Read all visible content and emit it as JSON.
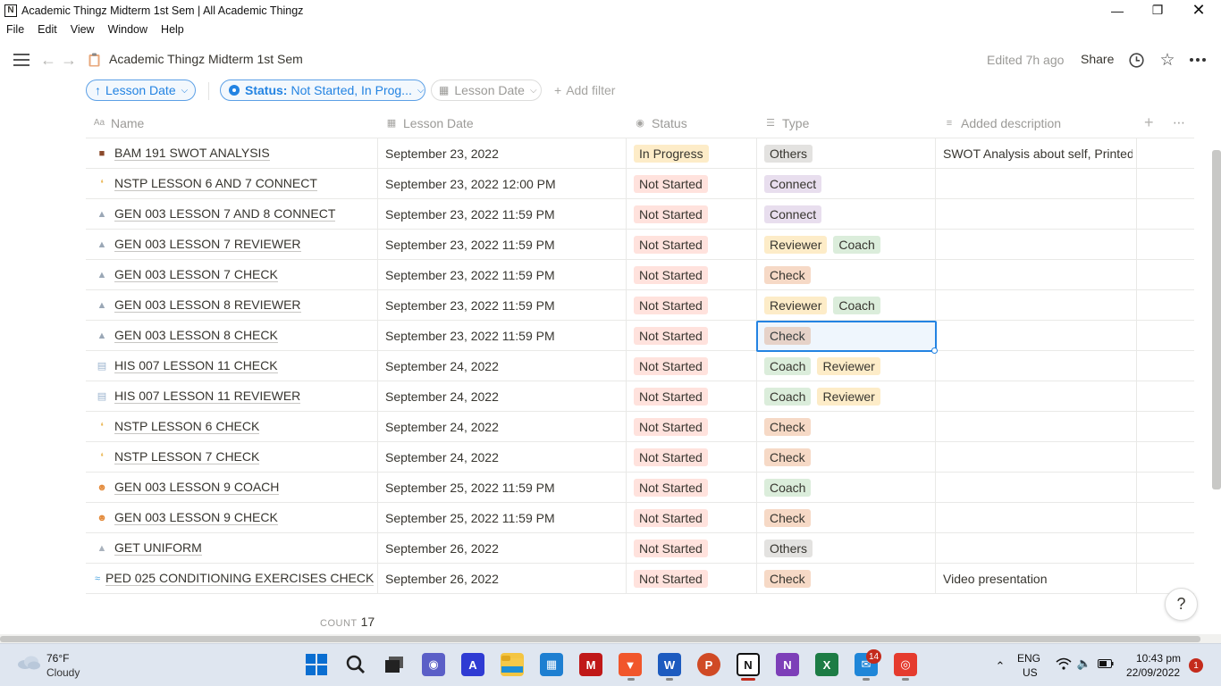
{
  "window": {
    "title": "Academic Thingz Midterm 1st Sem | All Academic Thingz"
  },
  "menu": [
    "File",
    "Edit",
    "View",
    "Window",
    "Help"
  ],
  "topbar": {
    "page_title": "Academic Thingz Midterm 1st Sem",
    "edited": "Edited 7h ago",
    "share": "Share"
  },
  "filters": {
    "sort_label": "Lesson Date",
    "status_key": "Status:",
    "status_value": "Not Started, In Prog...",
    "date_filter": "Lesson Date",
    "add_filter": "Add filter"
  },
  "columns": [
    "Name",
    "Lesson Date",
    "Status",
    "Type",
    "Added description"
  ],
  "tag_colors": {
    "In Progress": "#fdecc8",
    "Not Started": "#ffe2dd",
    "Others": "#e3e2e0",
    "Connect": "#e8deee",
    "Reviewer": "#fdecc8",
    "Coach": "#dbeddb",
    "Check": "#f6d9c6"
  },
  "rows": [
    {
      "icon": "briefcase-icon",
      "name": "BAM 191 SWOT ANALYSIS",
      "date": "September 23, 2022",
      "status": "In Progress",
      "types": [
        "Others"
      ],
      "description": "SWOT Analysis about self, Printed"
    },
    {
      "icon": "broom-icon",
      "name": "NSTP LESSON 6 AND 7 CONNECT",
      "date": "September 23, 2022 12:00 PM",
      "status": "Not Started",
      "types": [
        "Connect"
      ],
      "description": ""
    },
    {
      "icon": "microscope-icon",
      "name": "GEN 003 LESSON 7 AND 8 CONNECT",
      "date": "September 23, 2022 11:59 PM",
      "status": "Not Started",
      "types": [
        "Connect"
      ],
      "description": ""
    },
    {
      "icon": "microscope-icon",
      "name": "GEN 003 LESSON 7 REVIEWER",
      "date": "September 23, 2022 11:59 PM",
      "status": "Not Started",
      "types": [
        "Reviewer",
        "Coach"
      ],
      "description": ""
    },
    {
      "icon": "microscope-icon",
      "name": "GEN 003 LESSON 7 CHECK",
      "date": "September 23, 2022 11:59 PM",
      "status": "Not Started",
      "types": [
        "Check"
      ],
      "description": ""
    },
    {
      "icon": "microscope-icon",
      "name": "GEN 003 LESSON 8 REVIEWER",
      "date": "September 23, 2022 11:59 PM",
      "status": "Not Started",
      "types": [
        "Reviewer",
        "Coach"
      ],
      "description": ""
    },
    {
      "icon": "microscope-icon",
      "name": "GEN 003 LESSON 8 CHECK",
      "date": "September 23, 2022 11:59 PM",
      "status": "Not Started",
      "types": [
        "Check"
      ],
      "description": ""
    },
    {
      "icon": "book-icon",
      "name": "HIS 007 LESSON 11 CHECK",
      "date": "September 24, 2022",
      "status": "Not Started",
      "types": [
        "Coach",
        "Reviewer"
      ],
      "description": ""
    },
    {
      "icon": "book-icon",
      "name": "HIS 007 LESSON 11 REVIEWER",
      "date": "September 24, 2022",
      "status": "Not Started",
      "types": [
        "Coach",
        "Reviewer"
      ],
      "description": ""
    },
    {
      "icon": "broom-icon",
      "name": "NSTP LESSON 6 CHECK",
      "date": "September 24, 2022",
      "status": "Not Started",
      "types": [
        "Check"
      ],
      "description": ""
    },
    {
      "icon": "broom-icon",
      "name": "NSTP LESSON 7 CHECK",
      "date": "September 24, 2022",
      "status": "Not Started",
      "types": [
        "Check"
      ],
      "description": ""
    },
    {
      "icon": "person-icon",
      "name": "GEN 003 LESSON 9 COACH",
      "date": "September 25, 2022 11:59 PM",
      "status": "Not Started",
      "types": [
        "Coach"
      ],
      "description": ""
    },
    {
      "icon": "person-icon",
      "name": "GEN 003 LESSON 9 CHECK",
      "date": "September 25, 2022 11:59 PM",
      "status": "Not Started",
      "types": [
        "Check"
      ],
      "description": ""
    },
    {
      "icon": "uniform-icon",
      "name": "GET UNIFORM",
      "date": "September 26, 2022",
      "status": "Not Started",
      "types": [
        "Others"
      ],
      "description": ""
    },
    {
      "icon": "swimmer-icon",
      "name": "PED 025 CONDITIONING EXERCISES CHECK",
      "date": "September 26, 2022",
      "status": "Not Started",
      "types": [
        "Check"
      ],
      "description": "Video presentation"
    }
  ],
  "footer": {
    "count_label": "COUNT",
    "count_value": "17",
    "help": "?"
  },
  "taskbar": {
    "weather_temp": "76°F",
    "weather_desc": "Cloudy",
    "lang": "ENG",
    "region": "US",
    "time": "10:43 pm",
    "date": "22/09/2022",
    "mail_badge": "14",
    "notif_badge": "1"
  }
}
